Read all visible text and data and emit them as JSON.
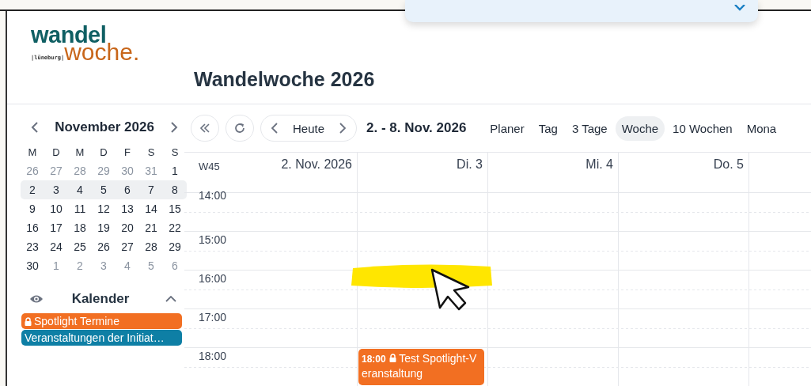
{
  "logo": {
    "top": "wandel",
    "place": "|lüneburg|",
    "bottom": "woche."
  },
  "title": "Wandelwoche 2026",
  "mini_calendar": {
    "month": "November 2026",
    "weekdays": [
      "M",
      "D",
      "M",
      "D",
      "F",
      "S",
      "S"
    ],
    "weeks": [
      {
        "selected": false,
        "days": [
          {
            "label": "26",
            "muted": true
          },
          {
            "label": "27",
            "muted": true
          },
          {
            "label": "28",
            "muted": true
          },
          {
            "label": "29",
            "muted": true
          },
          {
            "label": "30",
            "muted": true
          },
          {
            "label": "31",
            "muted": true
          },
          {
            "label": "1",
            "muted": false
          }
        ]
      },
      {
        "selected": true,
        "days": [
          {
            "label": "2",
            "muted": false
          },
          {
            "label": "3",
            "muted": false
          },
          {
            "label": "4",
            "muted": false
          },
          {
            "label": "5",
            "muted": false
          },
          {
            "label": "6",
            "muted": false
          },
          {
            "label": "7",
            "muted": false
          },
          {
            "label": "8",
            "muted": false
          }
        ]
      },
      {
        "selected": false,
        "days": [
          {
            "label": "9",
            "muted": false
          },
          {
            "label": "10",
            "muted": false
          },
          {
            "label": "11",
            "muted": false
          },
          {
            "label": "12",
            "muted": false
          },
          {
            "label": "13",
            "muted": false
          },
          {
            "label": "14",
            "muted": false
          },
          {
            "label": "15",
            "muted": false
          }
        ]
      },
      {
        "selected": false,
        "days": [
          {
            "label": "16",
            "muted": false
          },
          {
            "label": "17",
            "muted": false
          },
          {
            "label": "18",
            "muted": false
          },
          {
            "label": "19",
            "muted": false
          },
          {
            "label": "20",
            "muted": false
          },
          {
            "label": "21",
            "muted": false
          },
          {
            "label": "22",
            "muted": false
          }
        ]
      },
      {
        "selected": false,
        "days": [
          {
            "label": "23",
            "muted": false
          },
          {
            "label": "24",
            "muted": false
          },
          {
            "label": "25",
            "muted": false
          },
          {
            "label": "26",
            "muted": false
          },
          {
            "label": "27",
            "muted": false
          },
          {
            "label": "28",
            "muted": false
          },
          {
            "label": "29",
            "muted": false
          }
        ]
      },
      {
        "selected": false,
        "days": [
          {
            "label": "30",
            "muted": false
          },
          {
            "label": "1",
            "muted": true
          },
          {
            "label": "2",
            "muted": true
          },
          {
            "label": "3",
            "muted": true
          },
          {
            "label": "4",
            "muted": true
          },
          {
            "label": "5",
            "muted": true
          },
          {
            "label": "6",
            "muted": true
          }
        ]
      }
    ]
  },
  "calendars": {
    "heading": "Kalender",
    "expanded": true,
    "items": [
      {
        "name": "Spotlight Termine",
        "color": "#f26f22",
        "locked": true
      },
      {
        "name": "Veranstaltungen der Initiat…",
        "color": "#0e7fa5",
        "locked": false
      }
    ]
  },
  "toolbar": {
    "today": "Heute",
    "range": "2. - 8. Nov. 2026",
    "views": [
      {
        "label": "Planer",
        "selected": false
      },
      {
        "label": "Tag",
        "selected": false
      },
      {
        "label": "3 Tage",
        "selected": false
      },
      {
        "label": "Woche",
        "selected": true
      },
      {
        "label": "10 Wochen",
        "selected": false
      },
      {
        "label": "Mona",
        "selected": false
      }
    ]
  },
  "week": {
    "number": "W45",
    "columns": [
      {
        "label": "2. Nov. 2026"
      },
      {
        "label": "Di. 3",
        "events": [
          {
            "time": "18:00",
            "title": "Test Spotlight-Veranstaltung",
            "color": "#f26f22",
            "locked": true
          }
        ]
      },
      {
        "label": "Mi. 4"
      },
      {
        "label": "Do. 5"
      }
    ]
  },
  "hours": [
    "14:00",
    "15:00",
    "16:00",
    "17:00",
    "18:00"
  ]
}
